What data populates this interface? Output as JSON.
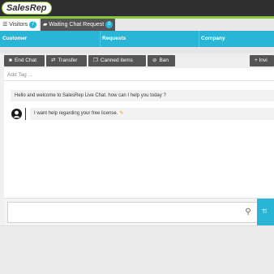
{
  "brand": {
    "logo_text": "SalesRep",
    "accent": "#29b6d6",
    "green": "#8cc63f",
    "dark": "#2f2f2f"
  },
  "tabs": [
    {
      "label": "Visitors",
      "count": "7",
      "icon": "list-icon"
    },
    {
      "label": "Waiting Chat Request",
      "count": "0",
      "icon": "chat-bubbles-icon"
    }
  ],
  "columns": [
    "Customer",
    "Requests",
    "Company"
  ],
  "toolbar": {
    "end_chat": "End Chat",
    "transfer": "Transfer",
    "canned_items": "Canned items",
    "ban": "Ban",
    "invite": "+ Invi"
  },
  "add_tag_placeholder": "Add Tag ...",
  "messages": [
    {
      "from": "agent",
      "text": "Hello and welcome to SalesRep Live Chat. how can I help you today ?"
    },
    {
      "from": "visitor",
      "text": "I want help regarding your free license."
    }
  ],
  "send_label": "Tl"
}
